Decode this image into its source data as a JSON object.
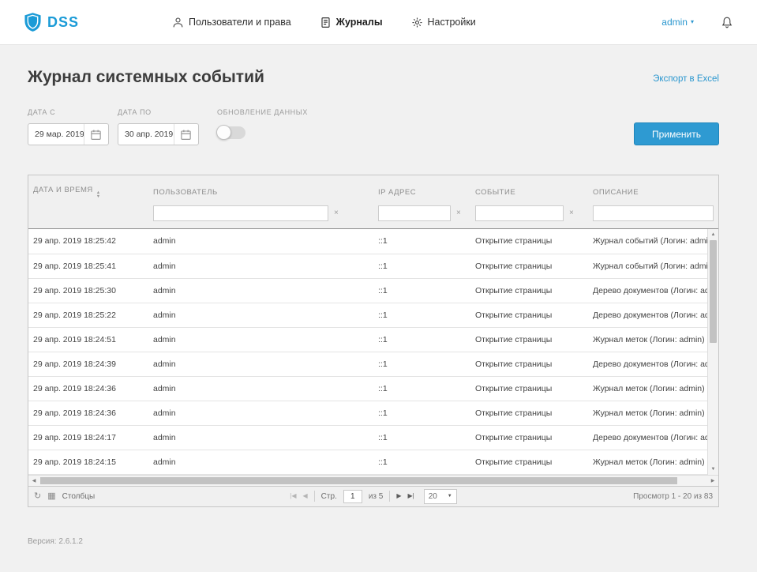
{
  "navbar": {
    "brand": "DSS",
    "items": [
      {
        "label": "Пользователи и права"
      },
      {
        "label": "Журналы"
      },
      {
        "label": "Настройки"
      }
    ],
    "user_menu": "admin"
  },
  "page": {
    "title": "Журнал системных событий",
    "export_link": "Экспорт в Excel",
    "version": "Версия: 2.6.1.2"
  },
  "filters": {
    "date_from_label": "ДАТА С",
    "date_from_value": "29 мар. 2019",
    "date_to_label": "ДАТА ПО",
    "date_to_value": "30 апр. 2019",
    "refresh_label": "ОБНОВЛЕНИЕ ДАННЫХ",
    "apply_button": "Применить"
  },
  "table": {
    "columns": [
      "ДАТА И ВРЕМЯ",
      "ПОЛЬЗОВАТЕЛЬ",
      "IP АДРЕС",
      "СОБЫТИЕ",
      "ОПИСАНИЕ"
    ],
    "rows": [
      {
        "datetime": "29 апр. 2019 18:25:42",
        "user": "admin",
        "ip": "::1",
        "event": "Открытие страницы",
        "description": "Журнал событий (Логин: admin)"
      },
      {
        "datetime": "29 апр. 2019 18:25:41",
        "user": "admin",
        "ip": "::1",
        "event": "Открытие страницы",
        "description": "Журнал событий (Логин: admin)"
      },
      {
        "datetime": "29 апр. 2019 18:25:30",
        "user": "admin",
        "ip": "::1",
        "event": "Открытие страницы",
        "description": "Дерево документов (Логин: admin)"
      },
      {
        "datetime": "29 апр. 2019 18:25:22",
        "user": "admin",
        "ip": "::1",
        "event": "Открытие страницы",
        "description": "Дерево документов (Логин: admin)"
      },
      {
        "datetime": "29 апр. 2019 18:24:51",
        "user": "admin",
        "ip": "::1",
        "event": "Открытие страницы",
        "description": "Журнал меток (Логин: admin)"
      },
      {
        "datetime": "29 апр. 2019 18:24:39",
        "user": "admin",
        "ip": "::1",
        "event": "Открытие страницы",
        "description": "Дерево документов (Логин: admin)"
      },
      {
        "datetime": "29 апр. 2019 18:24:36",
        "user": "admin",
        "ip": "::1",
        "event": "Открытие страницы",
        "description": "Журнал меток (Логин: admin)"
      },
      {
        "datetime": "29 апр. 2019 18:24:36",
        "user": "admin",
        "ip": "::1",
        "event": "Открытие страницы",
        "description": "Журнал меток (Логин: admin)"
      },
      {
        "datetime": "29 апр. 2019 18:24:17",
        "user": "admin",
        "ip": "::1",
        "event": "Открытие страницы",
        "description": "Дерево документов (Логин: admin)"
      },
      {
        "datetime": "29 апр. 2019 18:24:15",
        "user": "admin",
        "ip": "::1",
        "event": "Открытие страницы",
        "description": "Журнал меток (Логин: admin)"
      }
    ]
  },
  "pager": {
    "columns_label": "Столбцы",
    "page_label": "Стр.",
    "page_value": "1",
    "pages_total": "из 5",
    "page_size": "20",
    "view_info": "Просмотр 1 - 20 из 83"
  },
  "icons": {
    "caret_down": "▾",
    "sort_up": "▲",
    "sort_down": "▼",
    "clear": "×",
    "refresh": "↻",
    "columns": "▦",
    "first_page": "|◀",
    "prev_page": "◀",
    "next_page": "▶",
    "last_page": "▶|",
    "scroll_up": "▲",
    "scroll_down": "▼",
    "scroll_left": "◀",
    "scroll_right": "▶",
    "select_caret": "▼"
  }
}
